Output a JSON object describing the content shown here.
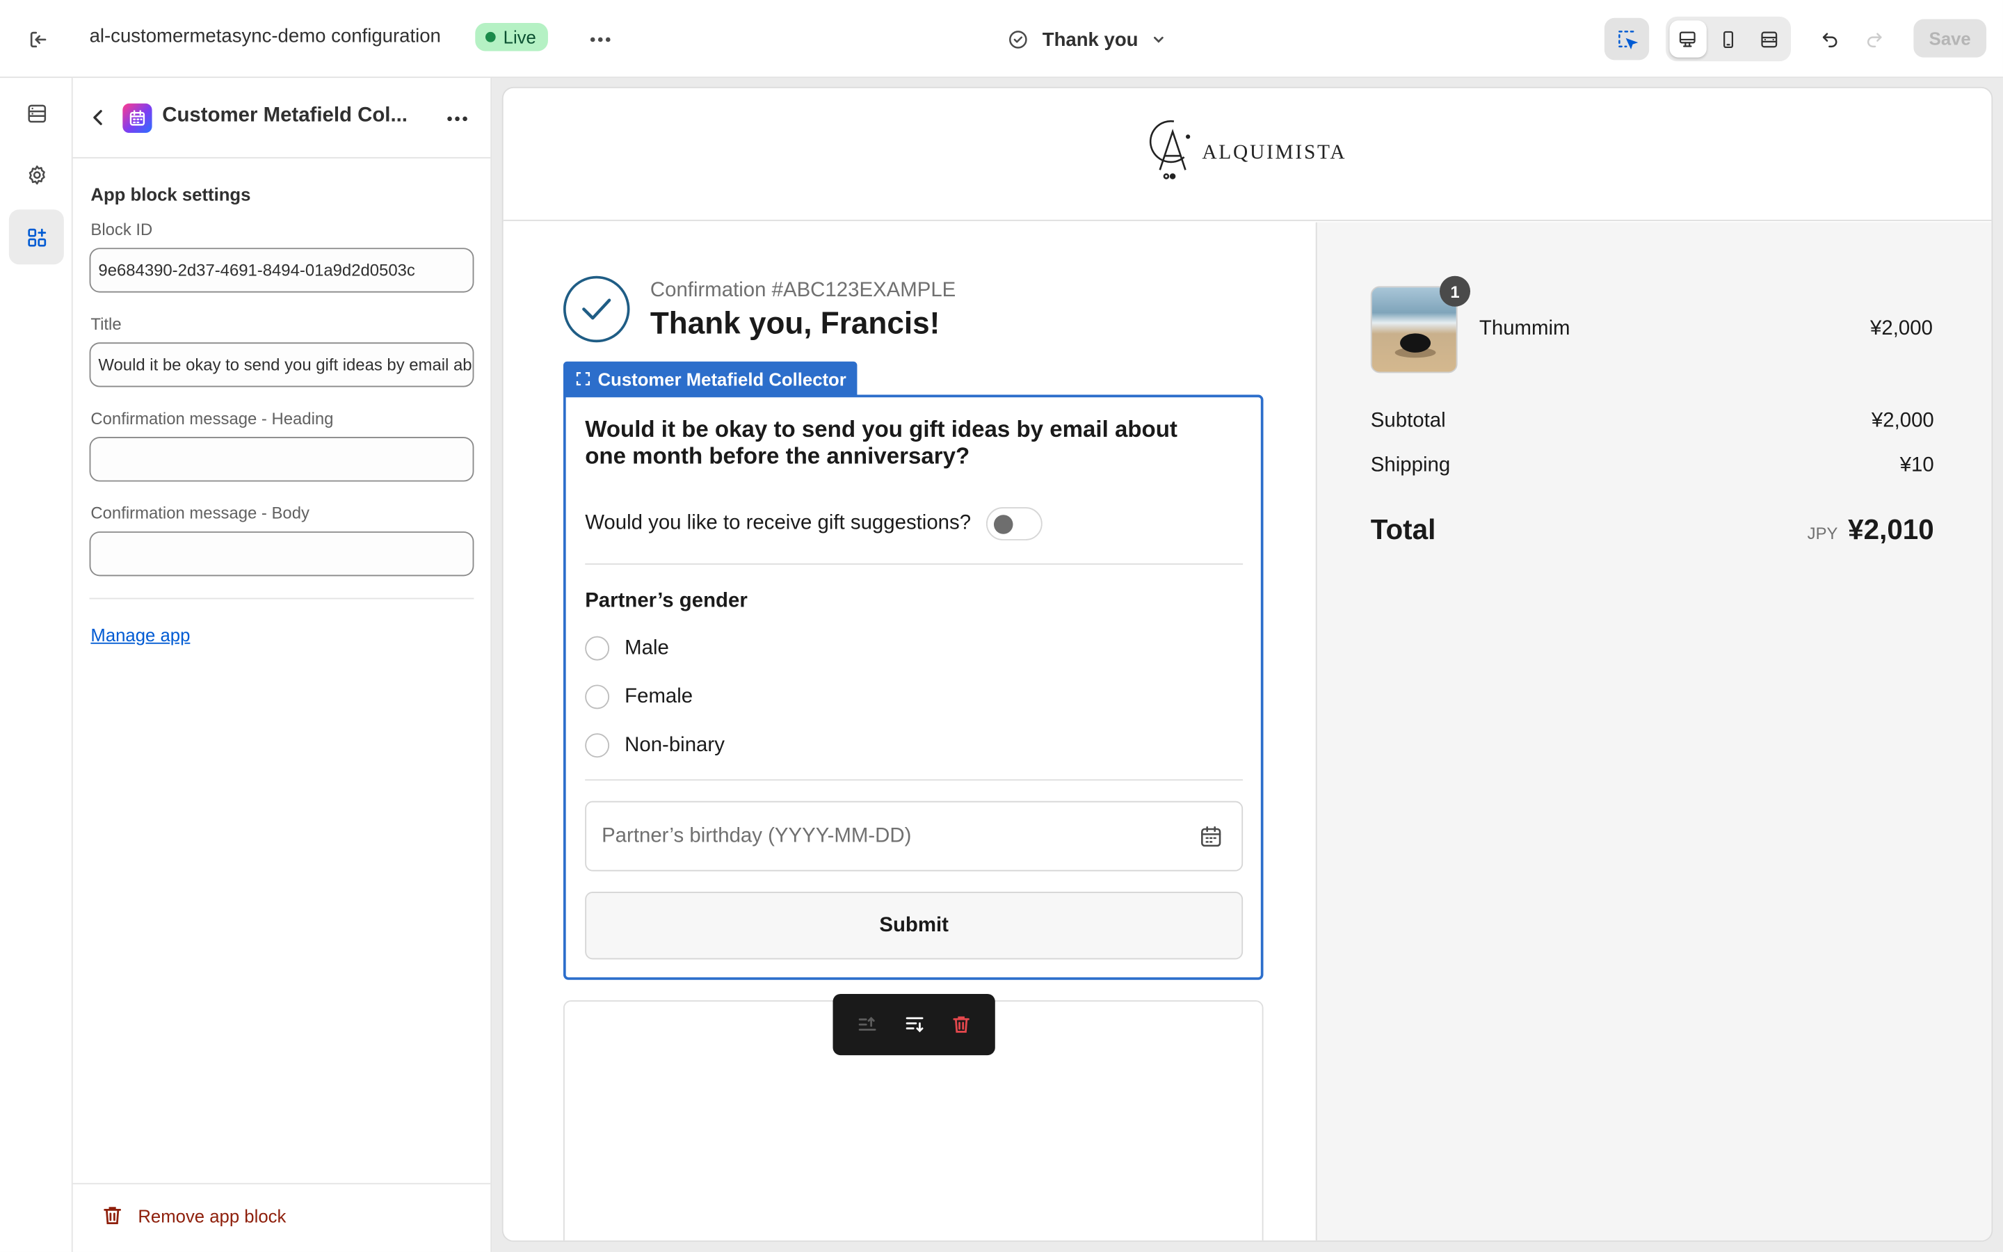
{
  "topbar": {
    "store_name": "al-customermetasync-demo configuration",
    "status_badge": "Live",
    "page_selector": "Thank you",
    "save_label": "Save"
  },
  "panel": {
    "title": "Customer Metafield Col...",
    "section_title": "App block settings",
    "fields": [
      {
        "label": "Block ID",
        "value": "9e684390-2d37-4691-8494-01a9d2d0503c"
      },
      {
        "label": "Title",
        "value": "Would it be okay to send you gift ideas by email about one month before the anniversary?"
      },
      {
        "label": "Confirmation message - Heading",
        "value": ""
      },
      {
        "label": "Confirmation message - Body",
        "value": ""
      }
    ],
    "manage_link": "Manage app",
    "remove_label": "Remove app block"
  },
  "preview": {
    "logo_text": "ALQUIMISTA",
    "confirmation_number": "Confirmation #ABC123EXAMPLE",
    "thanks_heading": "Thank you, Francis!",
    "block_tag": "Customer Metafield Collector",
    "block": {
      "question": "Would it be okay to send you gift ideas by email about one month before the anniversary?",
      "toggle_label": "Would you like to receive gift suggestions?",
      "toggle_on": false,
      "gender_title": "Partner’s gender",
      "gender_options": [
        "Male",
        "Female",
        "Non-binary"
      ],
      "birthday_placeholder": "Partner’s birthday (YYYY-MM-DD)",
      "submit_label": "Submit"
    },
    "summary": {
      "item_name": "Thummim",
      "item_qty": "1",
      "item_price": "¥2,000",
      "subtotal_label": "Subtotal",
      "subtotal_value": "¥2,000",
      "shipping_label": "Shipping",
      "shipping_value": "¥10",
      "total_label": "Total",
      "total_currency": "JPY",
      "total_value": "¥2,010"
    }
  },
  "colors": {
    "accent_blue": "#2c6ecb",
    "link_blue": "#005bd3",
    "live_badge_bg": "#b5f1c4",
    "danger_red": "#8e1f0b",
    "delete_icon_red": "#e5484d"
  },
  "icons": [
    "exit-icon",
    "more-horizontal-icon",
    "check-circle-icon",
    "chevron-down-icon",
    "inspector-icon",
    "desktop-icon",
    "mobile-icon",
    "fullwidth-icon",
    "undo-icon",
    "redo-icon",
    "sections-icon",
    "gear-icon",
    "apps-icon",
    "back-icon",
    "calendar-icon",
    "move-up-icon",
    "move-down-icon",
    "trash-icon"
  ]
}
